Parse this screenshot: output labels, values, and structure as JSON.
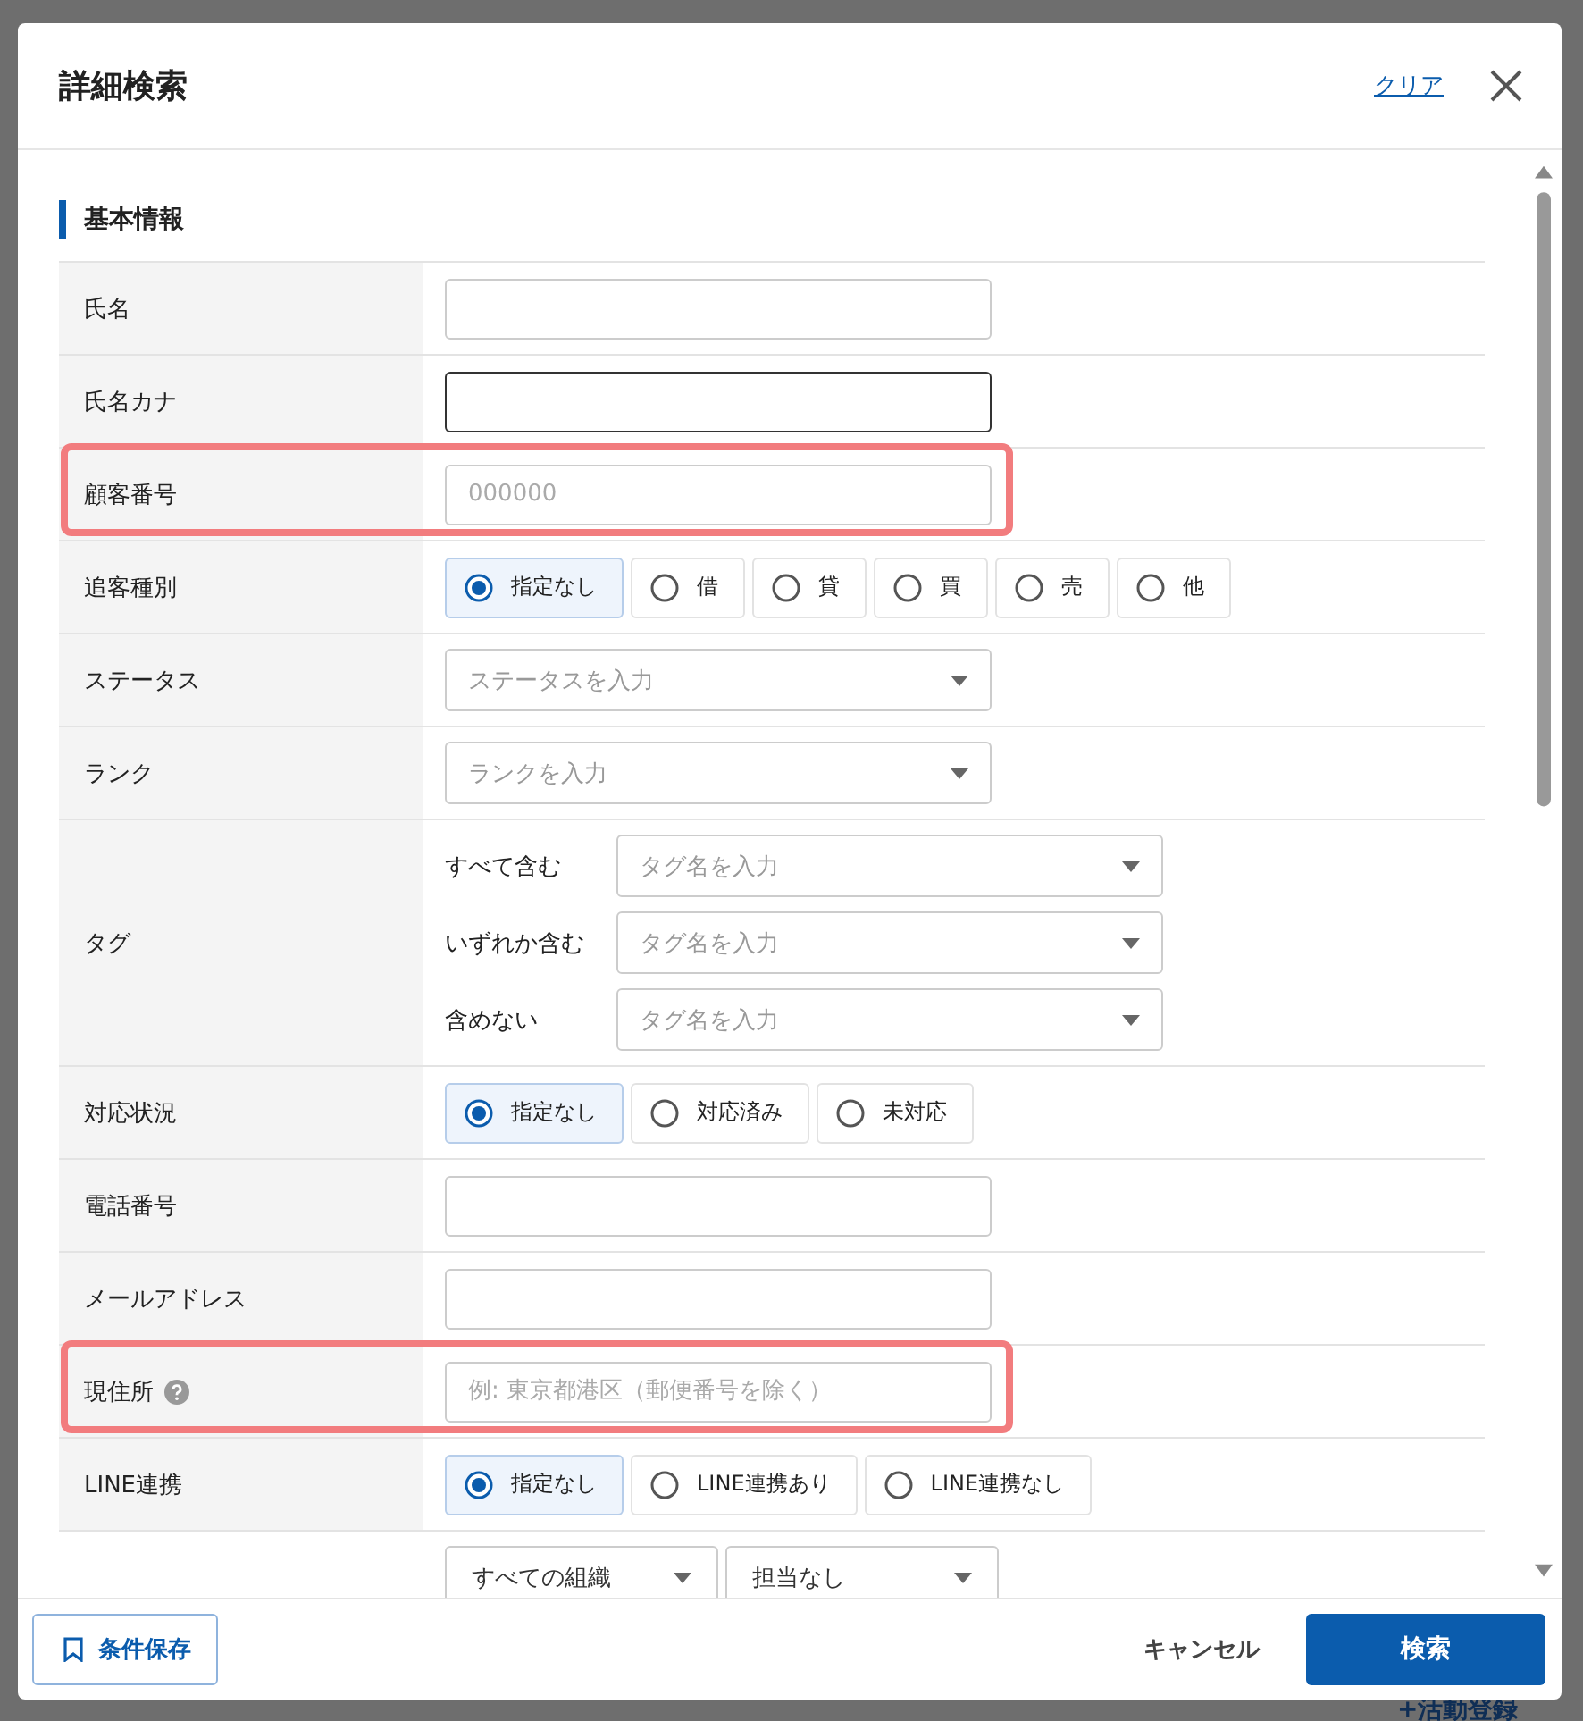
{
  "background": {
    "activity_link": "+活動登録"
  },
  "dialog": {
    "title": "詳細検索",
    "clear": "クリア",
    "section": "基本情報",
    "rows": [
      {
        "label": "氏名",
        "kind": "text",
        "focused": false,
        "highlighted": false
      },
      {
        "label": "氏名カナ",
        "kind": "text",
        "focused": true,
        "highlighted": false
      },
      {
        "label": "顧客番号",
        "kind": "text",
        "placeholder": "000000",
        "focused": false,
        "highlighted": true
      },
      {
        "label": "追客種別",
        "kind": "radio",
        "highlighted": false,
        "options": [
          {
            "label": "指定なし",
            "selected": true
          },
          {
            "label": "借",
            "selected": false
          },
          {
            "label": "貸",
            "selected": false
          },
          {
            "label": "買",
            "selected": false
          },
          {
            "label": "売",
            "selected": false
          },
          {
            "label": "他",
            "selected": false
          }
        ]
      },
      {
        "label": "ステータス",
        "kind": "select",
        "placeholder": "ステータスを入力",
        "highlighted": false
      },
      {
        "label": "ランク",
        "kind": "select",
        "placeholder": "ランクを入力",
        "highlighted": false
      },
      {
        "label": "タグ",
        "kind": "tags",
        "highlighted": false,
        "tags": [
          {
            "label": "すべて含む",
            "placeholder": "タグ名を入力"
          },
          {
            "label": "いずれか含む",
            "placeholder": "タグ名を入力"
          },
          {
            "label": "含めない",
            "placeholder": "タグ名を入力"
          }
        ]
      },
      {
        "label": "対応状況",
        "kind": "radio",
        "highlighted": false,
        "options": [
          {
            "label": "指定なし",
            "selected": true
          },
          {
            "label": "対応済み",
            "selected": false
          },
          {
            "label": "未対応",
            "selected": false
          }
        ]
      },
      {
        "label": "電話番号",
        "kind": "text",
        "focused": false,
        "highlighted": false
      },
      {
        "label": "メールアドレス",
        "kind": "text",
        "focused": false,
        "highlighted": false
      },
      {
        "label": "現住所",
        "kind": "text",
        "help": true,
        "placeholder": "例: 東京都港区（郵便番号を除く）",
        "focused": false,
        "highlighted": true
      },
      {
        "label": "LINE連携",
        "kind": "radio",
        "highlighted": false,
        "options": [
          {
            "label": "指定なし",
            "selected": true
          },
          {
            "label": "LINE連携あり",
            "selected": false
          },
          {
            "label": "LINE連携なし",
            "selected": false
          }
        ]
      },
      {
        "kind": "selects",
        "highlighted": false,
        "values": [
          "すべての組織",
          "担当なし"
        ]
      }
    ],
    "save_button": "条件保存",
    "cancel_button": "キャンセル",
    "search_button": "検索"
  }
}
